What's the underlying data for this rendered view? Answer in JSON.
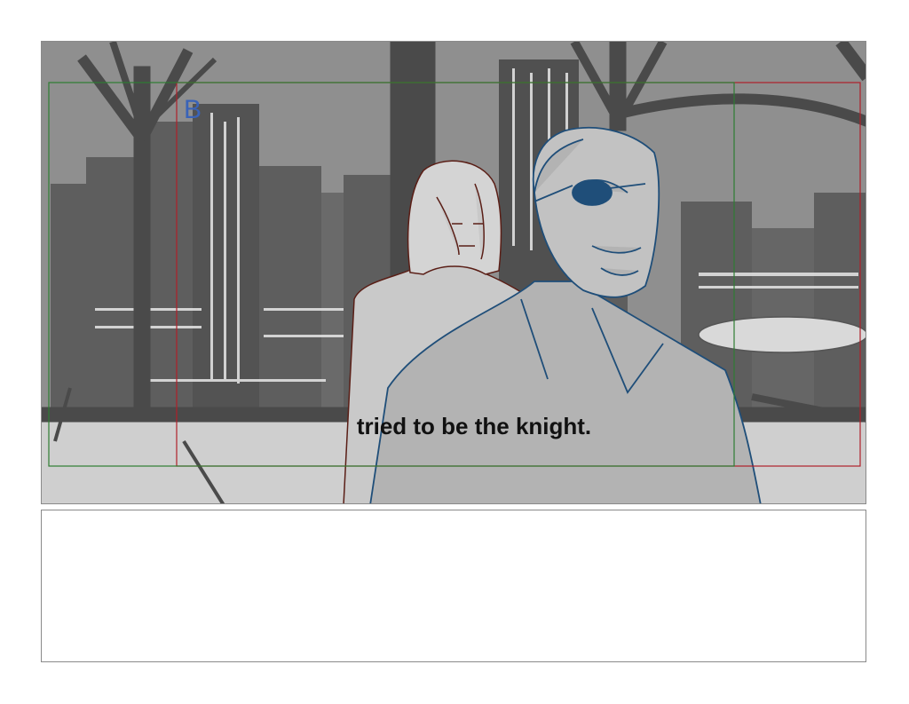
{
  "panel": {
    "label": "B",
    "caption": "tried to be the knight."
  },
  "colors": {
    "night_sky": "#8c8c8c",
    "window_frame": "#4a4a4a",
    "safe_frame_red": "#b0202a",
    "safe_frame_green": "#2e7d32",
    "man_line": "#1f4e79",
    "woman_line": "#5a1e16",
    "label_blue": "#3a63b8"
  },
  "notes": {
    "text": ""
  }
}
